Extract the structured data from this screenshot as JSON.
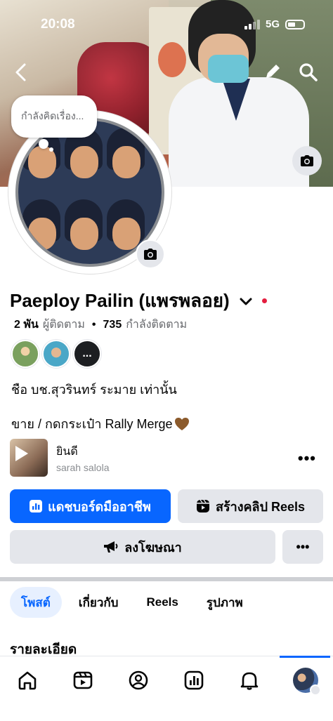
{
  "status_bar": {
    "time": "20:08",
    "network": "5G"
  },
  "cover": {
    "thought_bubble": "กำลังคิดเรื่อง..."
  },
  "profile": {
    "name": "Paeploy Pailin (แพรพลอย)",
    "followers_count": "2 พัน",
    "followers_label": "ผู้ติดตาม",
    "separator": "•",
    "following_count": "735",
    "following_label": "กำลังติดตาม",
    "friends_more_label": "..."
  },
  "bio": {
    "line1": "ชือ บช.สุวรินทร์  ระมาย เท่านั้น",
    "line2": "ขาย / กดกระเป๋า Rally Merge"
  },
  "music": {
    "title": "ยินดี",
    "artist": "sarah salola",
    "more_label": "•••"
  },
  "actions": {
    "dashboard_label": "แดชบอร์ดมืออาชีพ",
    "create_reels_label": "สร้างคลิป Reels",
    "ads_label": "ลงโฆษณา",
    "more_label": "•••"
  },
  "tabs": [
    {
      "label": "โพสต์",
      "active": true
    },
    {
      "label": "เกี่ยวกับ",
      "active": false
    },
    {
      "label": "Reels",
      "active": false
    },
    {
      "label": "รูปภาพ",
      "active": false
    }
  ],
  "section": {
    "title": "รายละเอียด"
  },
  "colors": {
    "primary": "#0866ff",
    "secondary_button": "#e4e6eb",
    "active_tab_bg": "#e7f0ff",
    "text": "#050505",
    "muted": "#65676b"
  },
  "icons": {
    "nav": [
      "home-icon",
      "video-icon",
      "friends-icon",
      "dashboard-icon",
      "bell-icon",
      "profile-menu-icon"
    ]
  }
}
